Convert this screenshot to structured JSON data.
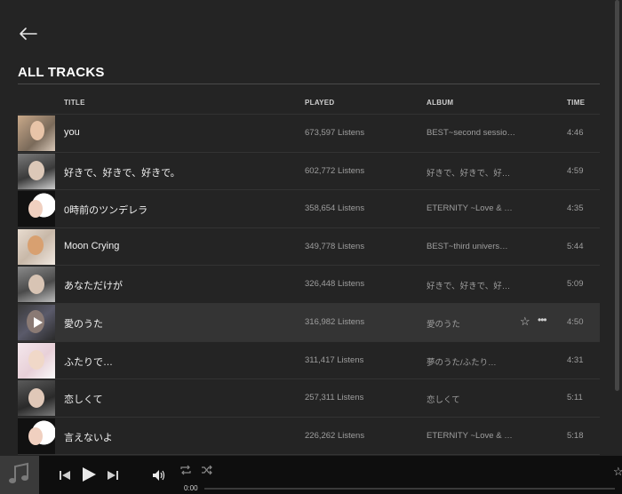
{
  "header": {
    "section_title": "ALL TRACKS"
  },
  "columns": {
    "title": "TITLE",
    "played": "PLAYED",
    "album": "ALBUM",
    "time": "TIME"
  },
  "tracks": [
    {
      "title": "you",
      "played": "673,597 Listens",
      "album": "BEST~second sessio…",
      "time": "4:46"
    },
    {
      "title": "好きで、好きで、好きで。",
      "played": "602,772 Listens",
      "album": "好きで、好きで、好…",
      "time": "4:59"
    },
    {
      "title": "0時前のツンデレラ",
      "played": "358,654 Listens",
      "album": "ETERNITY ~Love & …",
      "time": "4:35"
    },
    {
      "title": "Moon Crying",
      "played": "349,778 Listens",
      "album": "BEST~third univers…",
      "time": "5:44"
    },
    {
      "title": "あなただけが",
      "played": "326,448 Listens",
      "album": "好きで、好きで、好…",
      "time": "5:09"
    },
    {
      "title": "愛のうた",
      "played": "316,982 Listens",
      "album": "愛のうた",
      "time": "4:50"
    },
    {
      "title": "ふたりで…",
      "played": "311,417 Listens",
      "album": "夢のうた/ふたり…",
      "time": "4:31"
    },
    {
      "title": "恋しくて",
      "played": "257,311 Listens",
      "album": "恋しくて",
      "time": "5:11"
    },
    {
      "title": "言えないよ",
      "played": "226,262 Listens",
      "album": "ETERNITY ~Love & …",
      "time": "5:18"
    }
  ],
  "active_track_index": 5,
  "player": {
    "current_time": "0:00",
    "progress": 0
  },
  "icons": {
    "back": "arrow-left-icon",
    "star": "star-icon",
    "more": "more-icon",
    "prev": "previous-icon",
    "play": "play-icon",
    "next": "next-icon",
    "volume": "volume-icon",
    "repeat": "repeat-icon",
    "shuffle": "shuffle-icon",
    "music": "music-note-icon"
  },
  "colors": {
    "background": "#242424",
    "player_bar": "#0e0e0e",
    "active_row": "#343434"
  }
}
